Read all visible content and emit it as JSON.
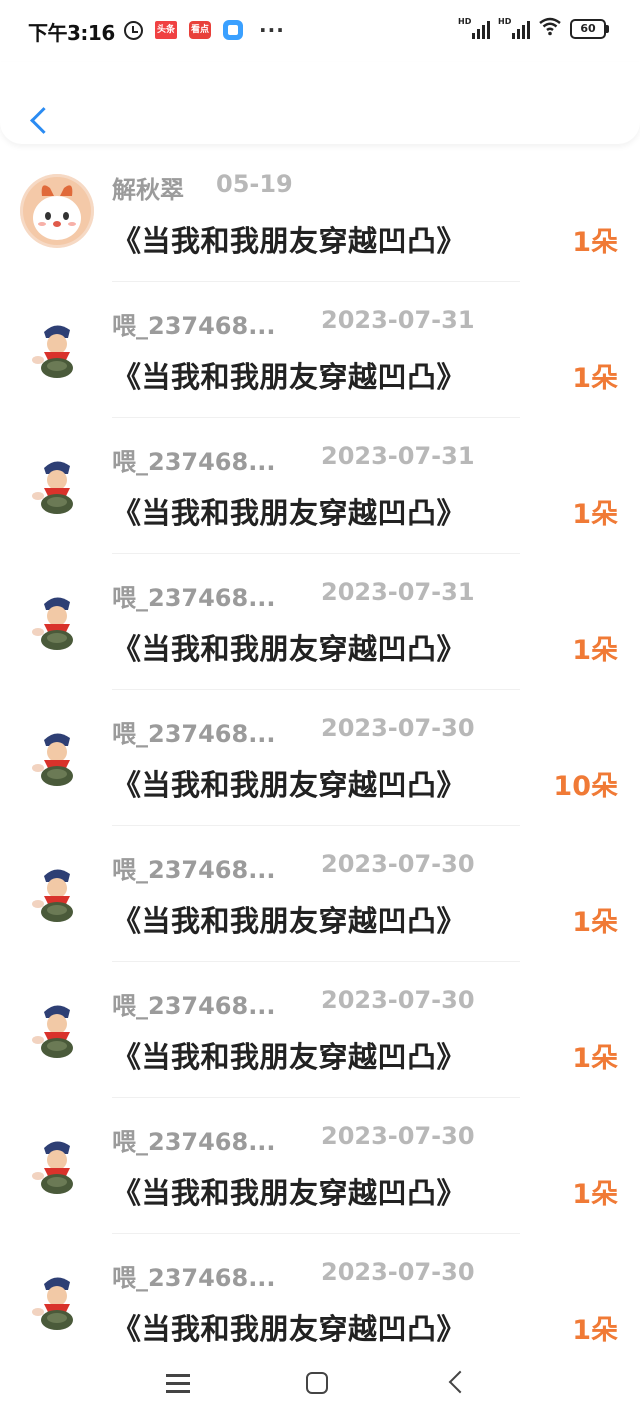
{
  "status_bar": {
    "time": "下午3:16",
    "app_badge_1": "头条",
    "app_badge_2": "看点",
    "more": "···",
    "network_1": "HD",
    "network_2": "HD",
    "battery": "60"
  },
  "header": {
    "back_icon": "chevron-left-icon"
  },
  "colors": {
    "accent": "#2a8bf2",
    "count": "#f07a36",
    "name": "#9b9b9b",
    "date": "#b8b8b8"
  },
  "records": [
    {
      "name": "解秋翠",
      "date": "05-19",
      "title": "《当我和我朋友穿越凹凸》",
      "count": "1朵",
      "avatar": "cute-bunny"
    },
    {
      "name": "喂_237468...",
      "date": "2023-07-31",
      "title": "《当我和我朋友穿越凹凸》",
      "count": "1朵",
      "avatar": "kid"
    },
    {
      "name": "喂_237468...",
      "date": "2023-07-31",
      "title": "《当我和我朋友穿越凹凸》",
      "count": "1朵",
      "avatar": "kid"
    },
    {
      "name": "喂_237468...",
      "date": "2023-07-31",
      "title": "《当我和我朋友穿越凹凸》",
      "count": "1朵",
      "avatar": "kid"
    },
    {
      "name": "喂_237468...",
      "date": "2023-07-30",
      "title": "《当我和我朋友穿越凹凸》",
      "count": "10朵",
      "avatar": "kid"
    },
    {
      "name": "喂_237468...",
      "date": "2023-07-30",
      "title": "《当我和我朋友穿越凹凸》",
      "count": "1朵",
      "avatar": "kid"
    },
    {
      "name": "喂_237468...",
      "date": "2023-07-30",
      "title": "《当我和我朋友穿越凹凸》",
      "count": "1朵",
      "avatar": "kid"
    },
    {
      "name": "喂_237468...",
      "date": "2023-07-30",
      "title": "《当我和我朋友穿越凹凸》",
      "count": "1朵",
      "avatar": "kid"
    },
    {
      "name": "喂_237468...",
      "date": "2023-07-30",
      "title": "《当我和我朋友穿越凹凸》",
      "count": "1朵",
      "avatar": "kid"
    }
  ],
  "nav_bar": {
    "menu_icon": "menu-icon",
    "home_icon": "home-icon",
    "back_icon": "back-icon"
  }
}
